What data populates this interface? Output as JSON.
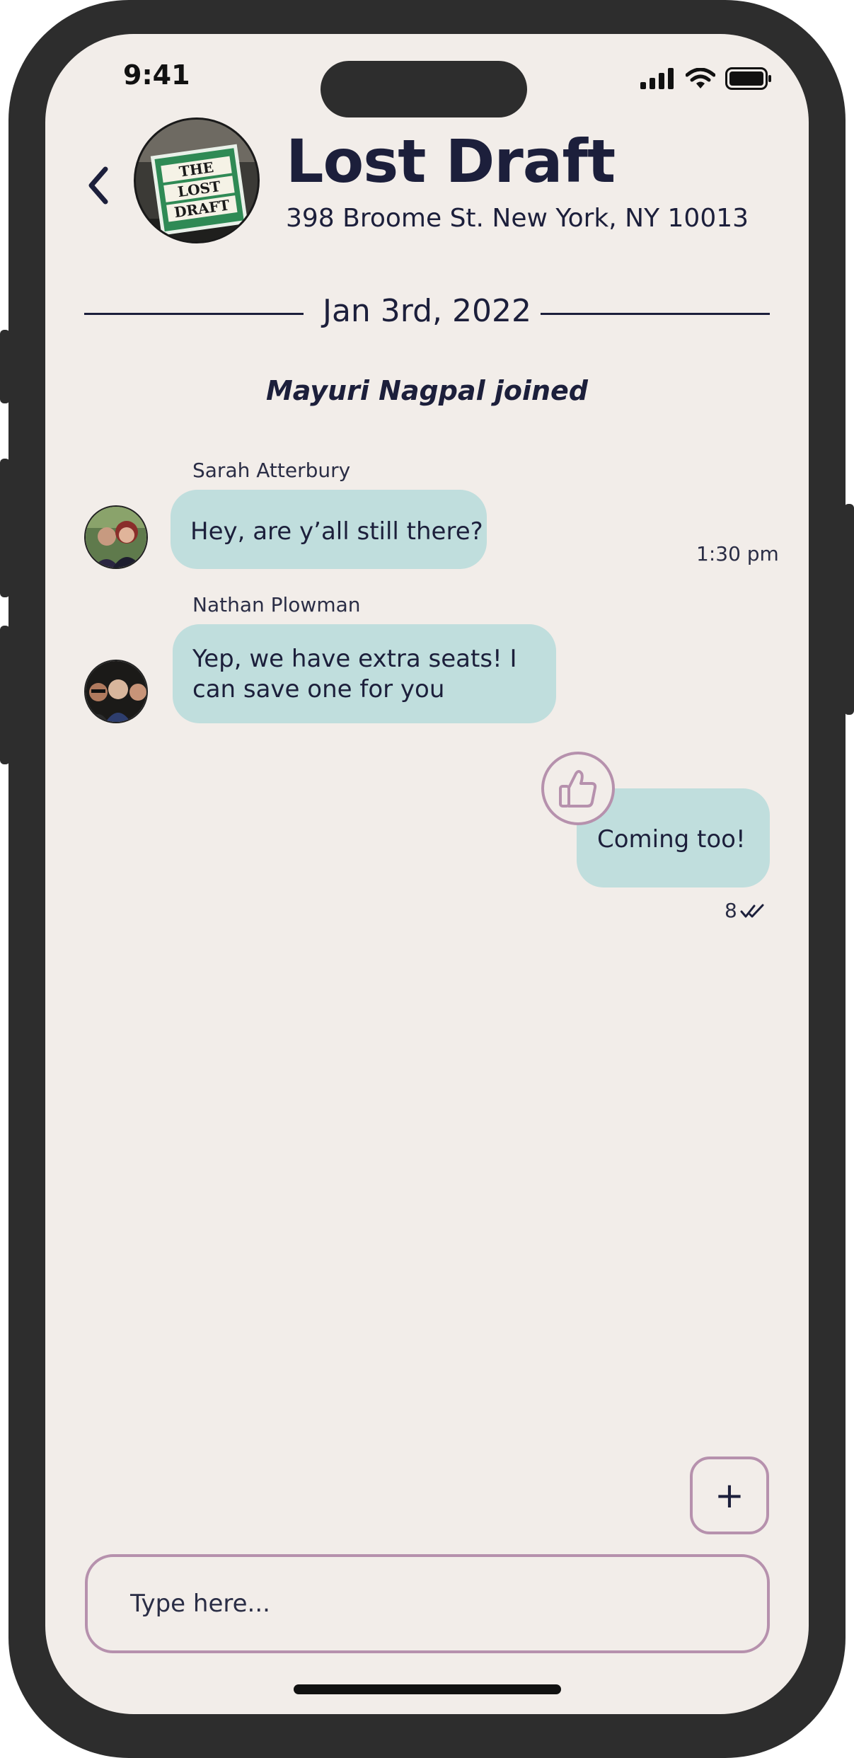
{
  "status_bar": {
    "time": "9:41",
    "icons": [
      "cellular-signal-icon",
      "wifi-icon",
      "battery-icon"
    ]
  },
  "header": {
    "back_icon": "chevron-left-icon",
    "venue_name": "Lost Draft",
    "address": "398 Broome St. New York, NY 10013",
    "avatar_sign_lines": [
      "THE",
      "LOST",
      "DRAFT"
    ]
  },
  "date_divider": "Jan 3rd, 2022",
  "system_notice": "Mayuri Nagpal joined",
  "messages": [
    {
      "sender": "Sarah Atterbury",
      "text": "Hey, are y’all still there?",
      "time": "1:30 pm",
      "direction": "incoming"
    },
    {
      "sender": "Nathan Plowman",
      "text": "Yep, we have extra seats! I can save one for you",
      "direction": "incoming"
    },
    {
      "text": "Coming too!",
      "direction": "outgoing",
      "reaction": "thumbs-up-icon",
      "read_count": "8",
      "receipt_icon": "double-check-icon"
    }
  ],
  "composer": {
    "add_label": "+",
    "placeholder": "Type here..."
  },
  "colors": {
    "background": "#f2ede9",
    "bubble": "#c0dedd",
    "text": "#1c1f3b",
    "accent_border": "#b691ad",
    "frame": "#2d2d2d"
  }
}
